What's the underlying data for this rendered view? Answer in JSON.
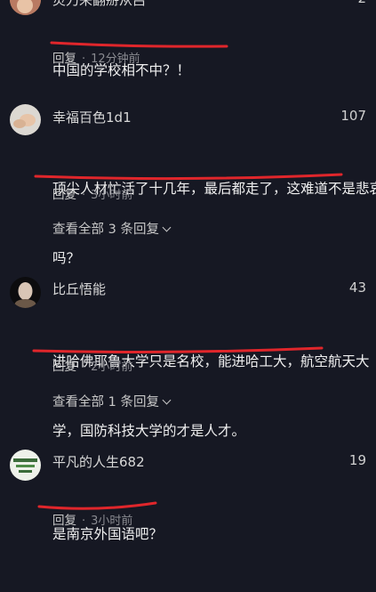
{
  "comments": [
    {
      "username": "灵刀来翻掰从吕",
      "likes": "2",
      "text_lines": [
        "中国的学校相不中？！"
      ],
      "reply_label": "回复",
      "time": "12分钟前"
    },
    {
      "username": "幸福百色1d1",
      "likes": "107",
      "text_lines": [
        "顶尖人材忙活了十几年，最后都走了，这难道不是悲哀",
        "吗？"
      ],
      "reply_label": "回复",
      "time": "3小时前",
      "view_all": "查看全部 3 条回复"
    },
    {
      "username": "比丘悟能",
      "likes": "43",
      "text_lines": [
        "进哈佛耶鲁大学只是名校，能进哈工大，航空航天大",
        "学，国防科技大学的才是人才。"
      ],
      "reply_label": "回复",
      "time": "2小时前",
      "view_all": "查看全部 1 条回复"
    },
    {
      "username": "平凡的人生682",
      "likes": "19",
      "text_lines": [
        "是南京外国语吧？"
      ],
      "reply_label": "回复",
      "time": "3小时前"
    }
  ],
  "colors": {
    "background": "#161823",
    "annotation_red": "#e0262b"
  }
}
